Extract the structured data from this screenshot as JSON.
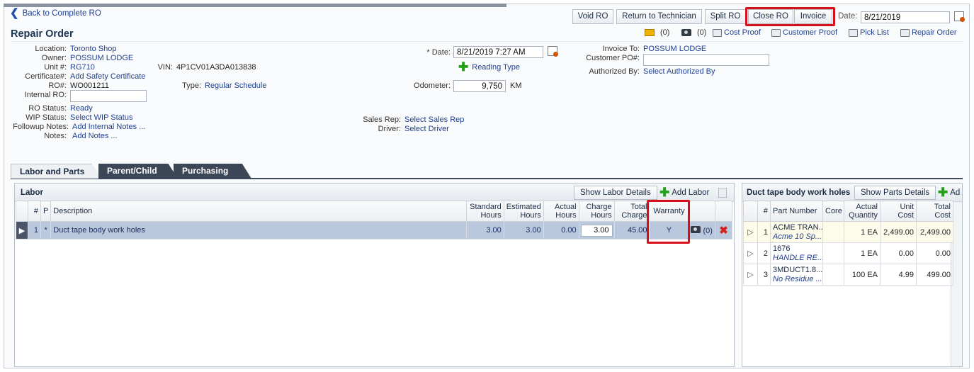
{
  "nav": {
    "back_label": "Back to Complete RO"
  },
  "toolbar": {
    "buttons": [
      "Void RO",
      "Return to Technician",
      "Split RO",
      "Close RO",
      "Invoice"
    ],
    "date_label": "Date:",
    "date_value": "8/21/2019"
  },
  "page_title": "Repair Order",
  "actions": {
    "messages_count": "(0)",
    "photos_count": "(0)",
    "cost_proof": "Cost Proof",
    "customer_proof": "Customer Proof",
    "pick_list": "Pick List",
    "repair_order": "Repair Order"
  },
  "details": {
    "location_label": "Location:",
    "location": "Toronto Shop",
    "owner_label": "Owner:",
    "owner": "POSSUM LODGE",
    "unit_label": "Unit #:",
    "unit": "RG710",
    "cert_label": "Certificate#:",
    "cert": "Add Safety Certificate",
    "ro_label": "RO#:",
    "ro": "WO001211",
    "internal_ro_label": "Internal RO:",
    "vin_label": "VIN:",
    "vin": "4P1CV01A3DA013838",
    "type_label": "Type:",
    "type": "Regular Schedule",
    "ro_status_label": "RO Status:",
    "ro_status": "Ready",
    "wip_label": "WIP Status:",
    "wip": "Select WIP Status",
    "followup_label": "Followup Notes:",
    "followup": "Add Internal Notes ...",
    "notes_label": "Notes:",
    "notes": "Add Notes ...",
    "date_label": "* Date:",
    "date_value": "8/21/2019 7:27 AM",
    "reading_type": "Reading Type",
    "odometer_label": "Odometer:",
    "odometer_value": "9,750",
    "odometer_unit": "KM",
    "sales_rep_label": "Sales Rep:",
    "sales_rep": "Select Sales Rep",
    "driver_label": "Driver:",
    "driver": "Select Driver",
    "invoice_to_label": "Invoice To:",
    "invoice_to": "POSSUM LODGE",
    "customer_po_label": "Customer PO#:",
    "authorized_label": "Authorized By:",
    "authorized": "Select Authorized By"
  },
  "tabs": [
    "Labor and Parts",
    "Parent/Child",
    "Purchasing"
  ],
  "labor": {
    "title": "Labor",
    "show_details": "Show Labor Details",
    "add_labor": "Add Labor",
    "columns": [
      "#",
      "P",
      "Description",
      "Standard Hours",
      "Estimated Hours",
      "Actual Hours",
      "Charge Hours",
      "Total Charge",
      "Warranty"
    ],
    "rows": [
      {
        "num": "1",
        "p": "*",
        "description": "Duct tape body work holes",
        "standard": "3.00",
        "estimated": "3.00",
        "actual": "0.00",
        "charge": "3.00",
        "total": "45.00",
        "warranty": "Y",
        "photos": "(0)"
      }
    ]
  },
  "parts": {
    "title": "Duct tape body work holes",
    "show_details": "Show Parts Details",
    "add_label": "Ad",
    "columns": [
      "#",
      "Part Number",
      "Core",
      "Actual Quantity",
      "Unit Cost",
      "Total Cost"
    ],
    "rows": [
      {
        "num": "1",
        "part": "ACME TRAN...",
        "desc": "Acme 10 Sp...",
        "core": "",
        "qty": "1 EA",
        "unit": "2,499.00",
        "total": "2,499.00"
      },
      {
        "num": "2",
        "part": "1676",
        "desc": "HANDLE RE...",
        "core": "",
        "qty": "1 EA",
        "unit": "0.00",
        "total": "0.00"
      },
      {
        "num": "3",
        "part": "3MDUCT1.8...",
        "desc": "No Residue ...",
        "core": "",
        "qty": "100 EA",
        "unit": "4.99",
        "total": "499.00"
      }
    ]
  },
  "colors": {
    "highlight": "#d5101a",
    "selected_row": "#b9c8dd",
    "link": "#1f3f8f"
  }
}
